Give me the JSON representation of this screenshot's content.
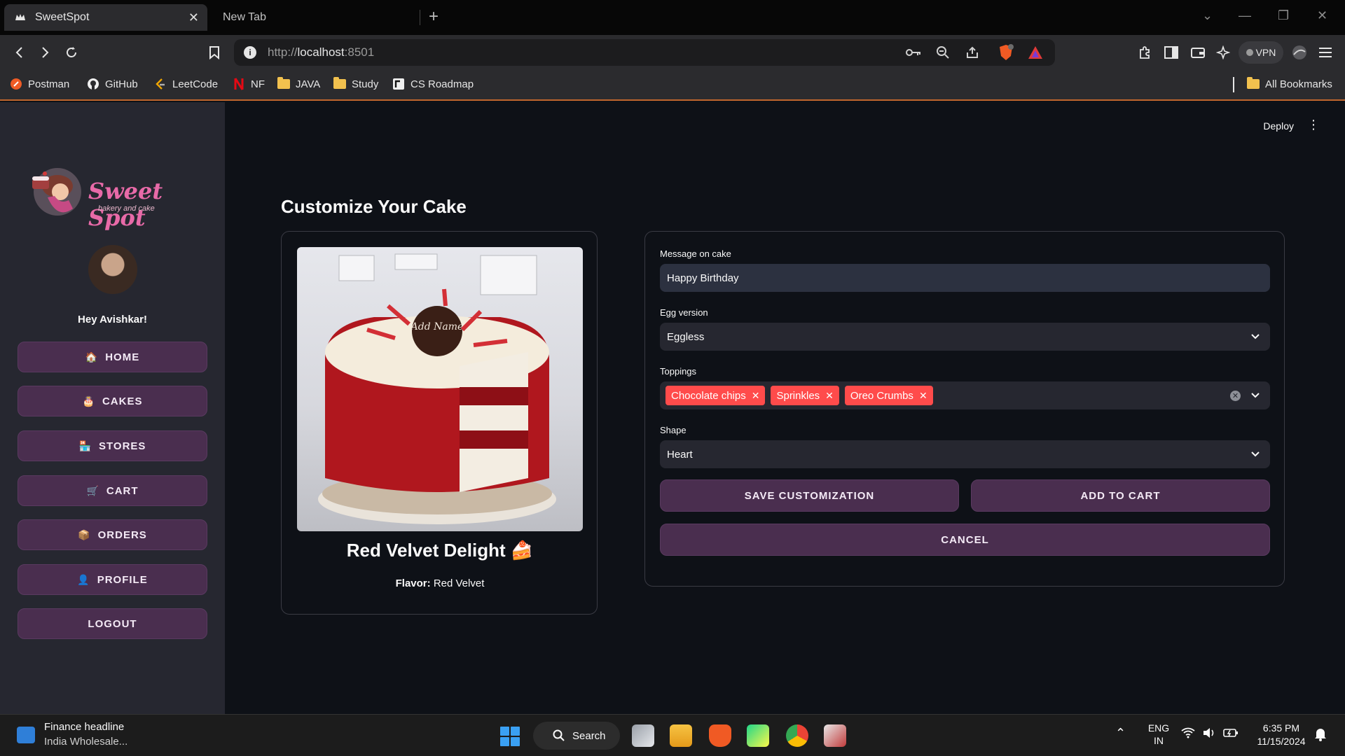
{
  "browser": {
    "active_tab_title": "SweetSpot",
    "inactive_tab_title": "New Tab",
    "url_scheme": "http://",
    "url_host": "localhost",
    "url_port": ":8501",
    "vpn_label": "VPN",
    "bookmarks": [
      "Postman",
      "GitHub",
      "LeetCode",
      "NF",
      "JAVA",
      "Study",
      "CS Roadmap"
    ],
    "all_bookmarks_label": "All Bookmarks"
  },
  "app": {
    "deploy_label": "Deploy",
    "logo_text": "Sweet Spot",
    "logo_subtitle": "bakery and cake",
    "greeting": "Hey Avishkar!",
    "nav": [
      {
        "emoji": "🏠",
        "label": "HOME"
      },
      {
        "emoji": "🎂",
        "label": "CAKES"
      },
      {
        "emoji": "🏪",
        "label": "STORES"
      },
      {
        "emoji": "🛒",
        "label": "CART"
      },
      {
        "emoji": "📦",
        "label": "ORDERS"
      },
      {
        "emoji": "👤",
        "label": "PROFILE"
      },
      {
        "emoji": "",
        "label": "LOGOUT"
      }
    ]
  },
  "page": {
    "title": "Customize Your Cake",
    "cake": {
      "image_text": "Add Name",
      "name": "Red Velvet Delight 🍰",
      "flavor_label": "Flavor:",
      "flavor_value": "Red Velvet"
    },
    "form": {
      "message_label": "Message on cake",
      "message_value": "Happy Birthday",
      "egg_label": "Egg version",
      "egg_value": "Eggless",
      "toppings_label": "Toppings",
      "toppings": [
        "Chocolate chips",
        "Sprinkles",
        "Oreo Crumbs"
      ],
      "shape_label": "Shape",
      "shape_value": "Heart",
      "save_button": "SAVE CUSTOMIZATION",
      "add_to_cart_button": "ADD TO CART",
      "cancel_button": "CANCEL"
    }
  },
  "taskbar": {
    "news_title": "Finance headline",
    "news_subtitle": "India Wholesale...",
    "search_label": "Search",
    "lang_line1": "ENG",
    "lang_line2": "IN",
    "time": "6:35 PM",
    "date": "11/15/2024"
  },
  "colors": {
    "sidebar_bg": "#262730",
    "main_bg": "#0e1117",
    "button_bg": "#4a2e4f",
    "chip_bg": "#ff4b4b",
    "logo_pink": "#e86aa8"
  }
}
